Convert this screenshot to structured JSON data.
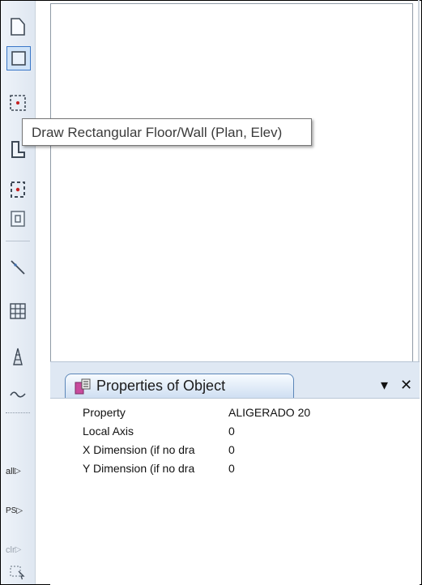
{
  "tooltip": {
    "text": "Draw Rectangular Floor/Wall (Plan, Elev)"
  },
  "toolbar": {
    "buttons": [
      "draw-polygon-icon",
      "draw-rectangle-icon",
      "point-object-icon",
      "draw-corner-icon",
      "draw-region-icon",
      "wall-opening-icon",
      "draw-line-icon",
      "grid-icon",
      "tower-icon",
      "wave-icon"
    ],
    "text_buttons": {
      "all": "all",
      "ps": "PS",
      "clr": "clr"
    }
  },
  "panel": {
    "title": "Properties of Object",
    "menu_icon": "▾",
    "close_icon": "✕",
    "rows": [
      {
        "name": "Property",
        "value": "ALIGERADO 20"
      },
      {
        "name": "Local Axis",
        "value": "0"
      },
      {
        "name": "X Dimension (if no dra",
        "value": "0"
      },
      {
        "name": "Y Dimension (if no dra",
        "value": "0"
      }
    ]
  },
  "colors": {
    "accent": "#3a77c8",
    "panel_bg": "#dfe8f3",
    "tab_border": "#5b86b8"
  }
}
